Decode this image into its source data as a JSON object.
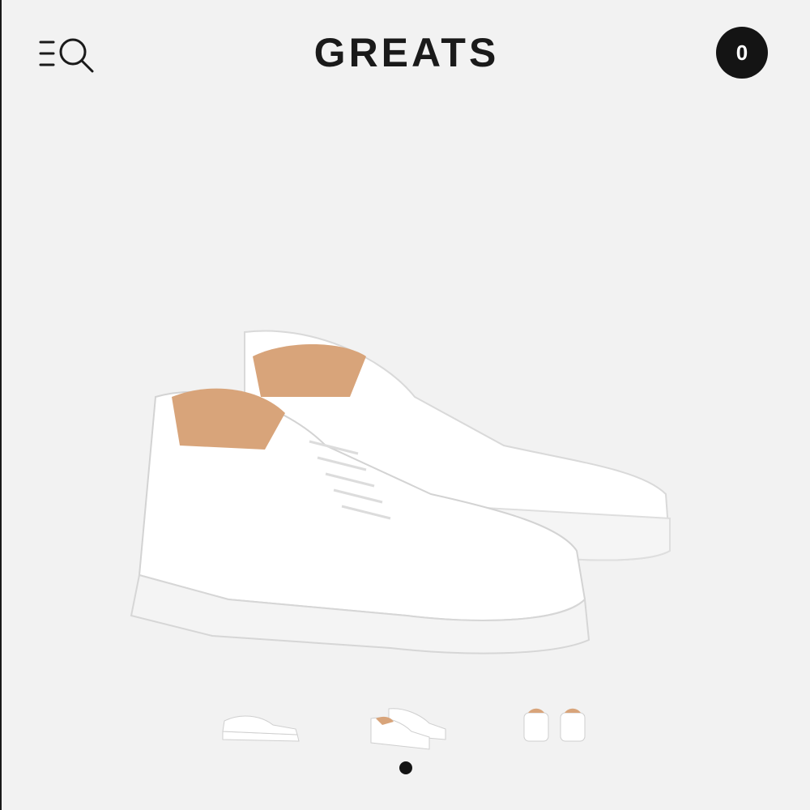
{
  "header": {
    "brand": "GREATS",
    "cart_count": "0",
    "menu_icon": "menu-search-icon"
  },
  "gallery": {
    "product_color": "#ffffff",
    "lining_color": "#d8a47a",
    "thumbnails": [
      {
        "view": "side"
      },
      {
        "view": "pair-angle"
      },
      {
        "view": "heels"
      }
    ],
    "active_index": 1
  }
}
